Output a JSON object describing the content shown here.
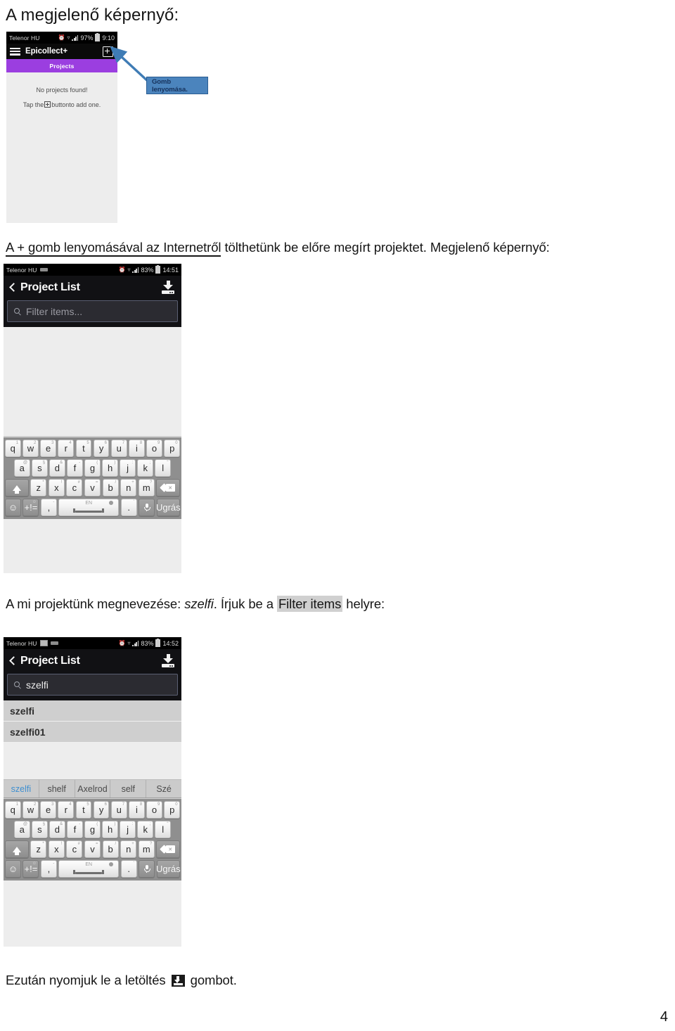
{
  "document": {
    "heading": "A megjelenő képernyő:",
    "paragraph_1_prefix": "A + gomb lenyomásával az Internetről",
    "paragraph_1_rest": " tölthetünk be előre megírt projektet.  Megjelenő képernyő:",
    "paragraph_2_a": "A mi projektünk megnevezése: ",
    "paragraph_2_italic": "szelfi",
    "paragraph_2_b": ". Írjuk be a ",
    "paragraph_2_highlight": "Filter items",
    "paragraph_2_c": " helyre:",
    "paragraph_3_a": "Ezután nyomjuk le a letöltés ",
    "paragraph_3_b": " gombot.",
    "page_number": "4"
  },
  "callout": {
    "text": "Gomb lenyomása.",
    "fill_color": "#4b84bd",
    "border_color": "#2a5d92",
    "text_color": "#16325c",
    "arrow_color": "#3f7cb5"
  },
  "shot1": {
    "status": {
      "carrier": "Telenor HU",
      "battery": "97%",
      "time": "9:10"
    },
    "appbar": {
      "title": "Epicollect+",
      "menu_icon": "hamburger-icon",
      "add_icon": "plus-box-icon"
    },
    "tab_label": "Projects",
    "tab_color": "#9b3ee0",
    "empty_title": "No projects found!",
    "empty_hint_a": "Tap the",
    "empty_hint_b": "buttonto add one."
  },
  "shot2": {
    "status": {
      "carrier": "Telenor HU",
      "battery": "83%",
      "time": "14:51"
    },
    "appbar": {
      "back_icon": "chevron-left-icon",
      "title": "Project List",
      "download_icon": "download-icon"
    },
    "search": {
      "placeholder": "Filter items...",
      "value": "",
      "icon": "search-icon"
    },
    "rows": []
  },
  "shot3": {
    "status": {
      "carrier": "Telenor HU",
      "battery": "83%",
      "time": "14:52"
    },
    "appbar": {
      "back_icon": "chevron-left-icon",
      "title": "Project List",
      "download_icon": "download-icon"
    },
    "search": {
      "placeholder": "Filter items...",
      "value": "szelfi",
      "icon": "search-icon"
    },
    "rows": [
      "szelfi",
      "szelfi01"
    ],
    "suggestions": [
      "szelfi",
      "shelf",
      "Axelrod",
      "self",
      "Szé"
    ]
  },
  "keyboard": {
    "row1": [
      {
        "k": "q",
        "s": "1"
      },
      {
        "k": "w",
        "s": "2"
      },
      {
        "k": "e",
        "s": "3"
      },
      {
        "k": "r",
        "s": "4"
      },
      {
        "k": "t",
        "s": "5"
      },
      {
        "k": "y",
        "s": "6"
      },
      {
        "k": "u",
        "s": "7"
      },
      {
        "k": "i",
        "s": "8"
      },
      {
        "k": "o",
        "s": "9"
      },
      {
        "k": "p",
        "s": "0"
      }
    ],
    "row2": [
      {
        "k": "a",
        "s": "@"
      },
      {
        "k": "s",
        "s": "§"
      },
      {
        "k": "d",
        "s": "&"
      },
      {
        "k": "f",
        "s": "-"
      },
      {
        "k": "g",
        "s": "("
      },
      {
        "k": "h",
        "s": ")"
      },
      {
        "k": "j",
        "s": ":"
      },
      {
        "k": "k",
        "s": ";"
      },
      {
        "k": "l",
        "s": "\""
      }
    ],
    "row3": [
      {
        "k": "z",
        "s": "*"
      },
      {
        "k": "x",
        "s": "!"
      },
      {
        "k": "c",
        "s": "#"
      },
      {
        "k": "v",
        "s": "="
      },
      {
        "k": "b",
        "s": "/"
      },
      {
        "k": "n",
        "s": "+"
      },
      {
        "k": "m",
        "s": "?"
      }
    ],
    "shift_icon": "shift-icon",
    "backspace_icon": "backspace-icon",
    "emoji_icon": "emoji-icon",
    "symbols_label": "+!=",
    "comma": ",",
    "comma_sec": "-",
    "period": ".",
    "period_sec": "'",
    "space_lang": "EN",
    "mic_icon": "microphone-icon",
    "enter_label": "Ugrás"
  }
}
